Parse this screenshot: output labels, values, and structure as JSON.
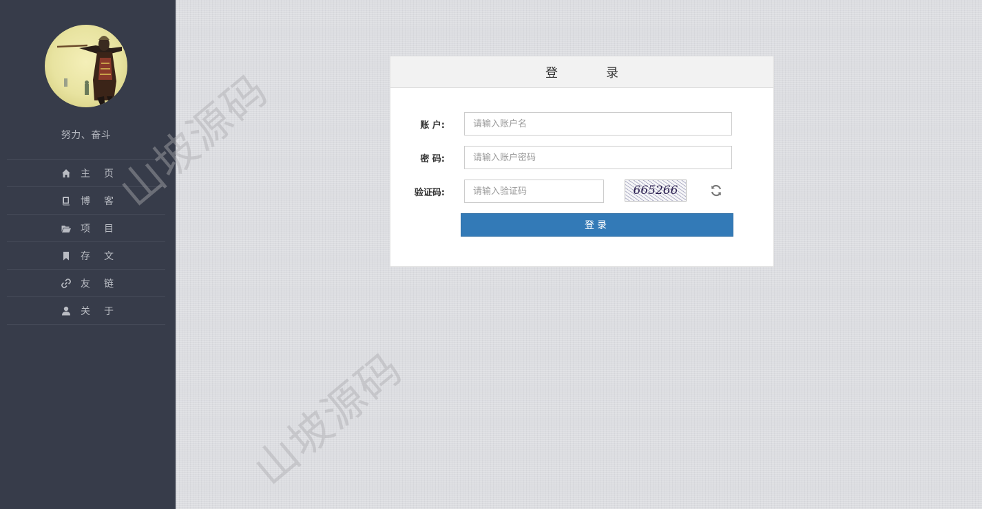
{
  "sidebar": {
    "motto": "努力、奋斗",
    "items": [
      {
        "label": "主页",
        "icon": "home-icon"
      },
      {
        "label": "博客",
        "icon": "book-icon"
      },
      {
        "label": "项目",
        "icon": "folder-open-icon"
      },
      {
        "label": "存文",
        "icon": "bookmark-icon"
      },
      {
        "label": "友链",
        "icon": "link-icon"
      },
      {
        "label": "关于",
        "icon": "user-icon"
      }
    ]
  },
  "watermark": "山坡源码",
  "login": {
    "title": "登录",
    "account_label": "账 户:",
    "account_placeholder": "请输入账户名",
    "password_label": "密 码:",
    "password_placeholder": "请输入账户密码",
    "captcha_label": "验证码:",
    "captcha_placeholder": "请输入验证码",
    "captcha_text": "665266",
    "submit_label": "登录"
  },
  "colors": {
    "sidebar_bg": "#373c4a",
    "primary_button": "#337ab7",
    "page_bg": "#dcdde1"
  }
}
